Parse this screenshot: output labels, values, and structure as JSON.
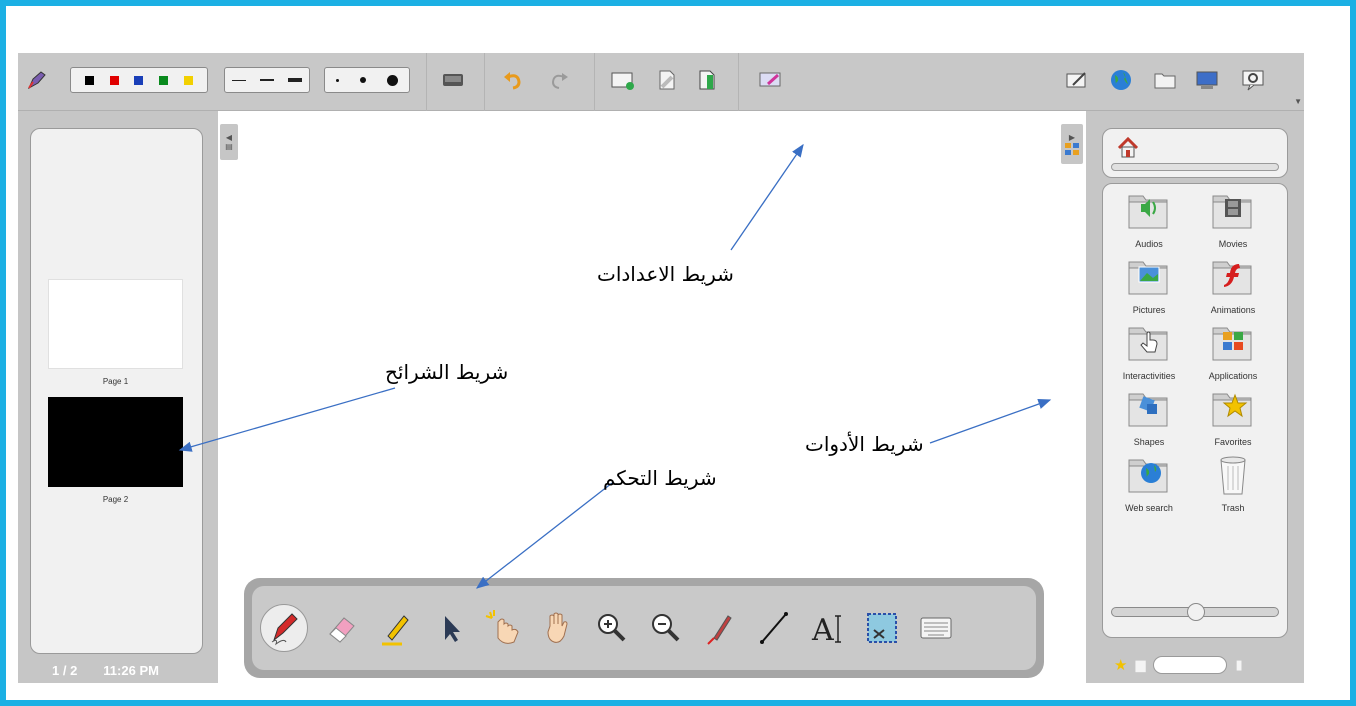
{
  "annotations": {
    "settings_bar": "شريط الاعدادات",
    "slides_bar": "شريط الشرائح",
    "tools_bar": "شريط الأدوات",
    "control_bar": "شريط التحكم"
  },
  "topbar": {
    "colors": [
      "#000000",
      "#e00000",
      "#1a3fb8",
      "#0a8a1e",
      "#f2d000"
    ],
    "icons": [
      "pen-settings-icon",
      "keyboard-icon",
      "undo-icon",
      "redo-icon",
      "new-page-icon",
      "page-icon",
      "page-color-icon",
      "clear-icon",
      "pen-tablet-icon",
      "globe-icon",
      "folder-icon",
      "screen-icon",
      "settings-icon"
    ]
  },
  "pages": [
    {
      "label": "Page 1",
      "bg": "#ffffff"
    },
    {
      "label": "Page 2",
      "bg": "#000000"
    }
  ],
  "status": {
    "page": "1 / 2",
    "time": "11:26 PM"
  },
  "library": {
    "items": [
      {
        "label": "Audios",
        "icon": "audio-folder-icon"
      },
      {
        "label": "Movies",
        "icon": "movie-folder-icon"
      },
      {
        "label": "Pictures",
        "icon": "pictures-folder-icon"
      },
      {
        "label": "Animations",
        "icon": "animations-folder-icon"
      },
      {
        "label": "Interactivities",
        "icon": "interactivities-folder-icon"
      },
      {
        "label": "Applications",
        "icon": "applications-folder-icon"
      },
      {
        "label": "Shapes",
        "icon": "shapes-folder-icon"
      },
      {
        "label": "Favorites",
        "icon": "favorites-folder-icon"
      },
      {
        "label": "Web search",
        "icon": "web-search-icon"
      },
      {
        "label": "Trash",
        "icon": "trash-icon"
      }
    ],
    "zoom_level": 0.5
  },
  "toolbox": {
    "tools": [
      "pen-icon",
      "eraser-icon",
      "highlighter-icon",
      "pointer-icon",
      "laser-hand-icon",
      "hand-icon",
      "zoom-in-icon",
      "zoom-out-icon",
      "laser-pointer-icon",
      "line-icon",
      "text-icon",
      "capture-icon",
      "virtual-keyboard-icon"
    ],
    "text_tool_glyph": "A"
  }
}
